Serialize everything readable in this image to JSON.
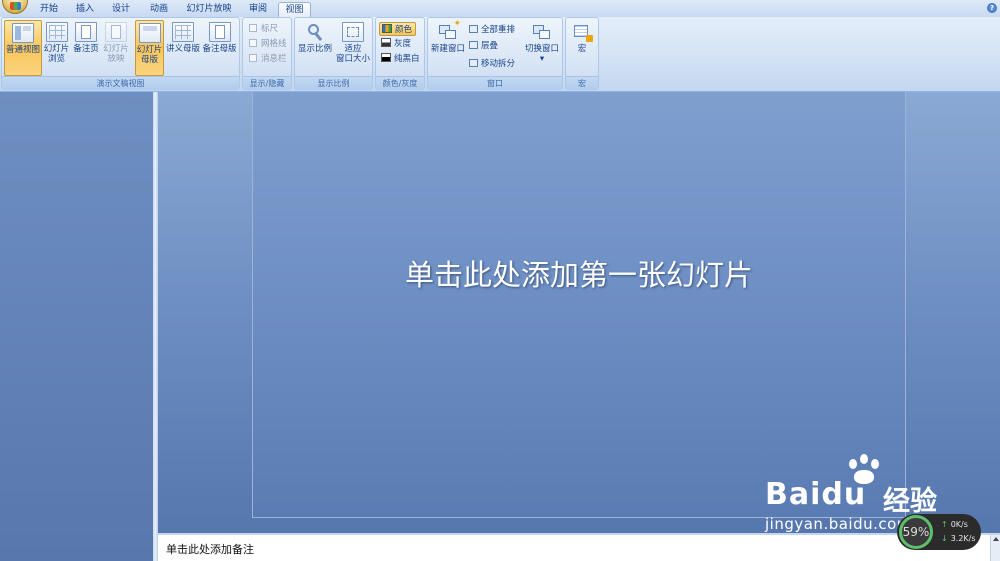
{
  "tabs": [
    {
      "label": "开始",
      "active": false
    },
    {
      "label": "插入",
      "active": false
    },
    {
      "label": "设计",
      "active": false
    },
    {
      "label": "动画",
      "active": false
    },
    {
      "label": "幻灯片放映",
      "active": false
    },
    {
      "label": "审阅",
      "active": false
    },
    {
      "label": "视图",
      "active": true
    }
  ],
  "ribbon": {
    "presentation_views": {
      "label": "演示文稿视图",
      "buttons": [
        {
          "line1": "普通视图",
          "line2": "",
          "state": "pressed",
          "icon": "normal-view-icon"
        },
        {
          "line1": "幻灯片",
          "line2": "浏览",
          "state": "normal",
          "icon": "slide-sorter-icon"
        },
        {
          "line1": "备注页",
          "line2": "",
          "state": "normal",
          "icon": "notes-page-icon"
        },
        {
          "line1": "幻灯片",
          "line2": "放映",
          "state": "disabled",
          "icon": "slideshow-icon"
        },
        {
          "line1": "幻灯片",
          "line2": "母版",
          "state": "pressed",
          "icon": "slide-master-icon"
        },
        {
          "line1": "讲义母版",
          "line2": "",
          "state": "normal",
          "icon": "handout-master-icon"
        },
        {
          "line1": "备注母版",
          "line2": "",
          "state": "normal",
          "icon": "notes-master-icon"
        }
      ]
    },
    "show_hide": {
      "label": "显示/隐藏",
      "items": [
        "标尺",
        "网格线",
        "消息栏"
      ]
    },
    "zoom": {
      "label": "显示比例",
      "zoom_button": "显示比例",
      "fit_line1": "适应",
      "fit_line2": "窗口大小"
    },
    "color_grayscale": {
      "label": "颜色/灰度",
      "items": [
        {
          "label": "颜色",
          "active": true
        },
        {
          "label": "灰度",
          "active": false
        },
        {
          "label": "纯黑白",
          "active": false
        }
      ]
    },
    "window": {
      "label": "窗口",
      "new_window": "新建窗口",
      "arrange_all": "全部重排",
      "cascade": "层叠",
      "move_split": "移动拆分",
      "switch_windows": "切换窗口",
      "switch_arrow": "▾"
    },
    "macros": {
      "label": "宏",
      "button": "宏"
    }
  },
  "slide": {
    "title_placeholder": "单击此处添加第一张幻灯片"
  },
  "notes": {
    "placeholder": "单击此处添加备注"
  },
  "watermark": {
    "brand": "Baidu",
    "brand_cn": "经验",
    "url": "jingyan.baidu.com"
  },
  "net_monitor": {
    "percent": "59%",
    "up": "0K/s",
    "down": "3.2K/s"
  },
  "colors": {
    "accent": "#15428b",
    "ribbon_pressed": "#f9c55a",
    "slide_bg": "#6d8ec3"
  }
}
